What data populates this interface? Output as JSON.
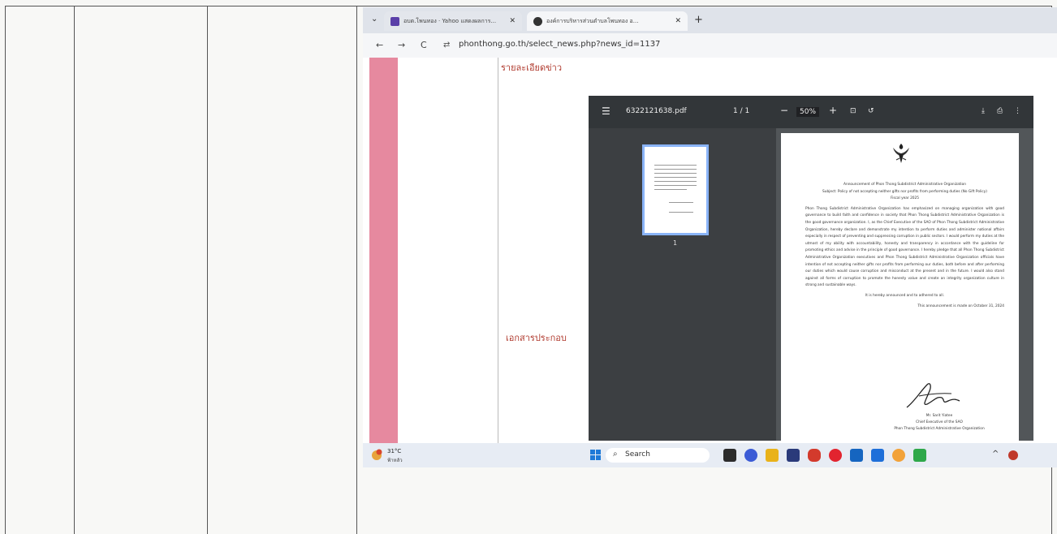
{
  "browser": {
    "tab_arrow": "⌄",
    "tabs": [
      {
        "label": "อบต.โพนทอง · Yahoo แสดงผลการ..."
      },
      {
        "label": "องค์การบริหารส่วนตำบลโพนทอง อ..."
      }
    ],
    "close": "✕",
    "new_tab": "+",
    "back": "←",
    "forward": "→",
    "reload": "C",
    "site_icon": "⇄",
    "url": "phonthong.go.th/select_news.php?news_id=1137"
  },
  "page": {
    "details_title": "รายละเอียดข่าว",
    "attachments_label": "เอกสารประกอบ"
  },
  "pdf_viewer": {
    "menu": "☰",
    "filename": "6322121638.pdf",
    "page_indicator": "1 / 1",
    "zoom_out": "−",
    "zoom": "50%",
    "zoom_in": "+",
    "fit": "⊡",
    "rotate": "↺",
    "download": "⤓",
    "print": "⎙",
    "more": "⋮",
    "thumbnail_page": "1",
    "document": {
      "heading1": "Announcement of Phon Thong Subdistrict Administrative Organization",
      "heading2": "Subject: Policy of not accepting neither gifts nor profits from performing duties (No Gift Policy)",
      "heading3": "Fiscal year 2025",
      "body": "Phon Thong Subdistrict Administrative Organization has emphasized on managing organization with good governance to build faith and confidence in society that Phon Thong Subdistrict Administrative Organization is the good governance organization. I, as the Chief Executive of the SAO of Phon Thong Subdistrict Administrative Organization, hereby declare and demonstrate my intention to perform duties and administer national affairs especially in respect of preventing and suppressing corruption in public sectors. I would perform my duties at the utmost of my ability with accountability, honesty and transparency in accordance with the guideline for promoting ethics and advise in the principle of good governance. I hereby pledge that all Phon Thong Subdistrict Administrative Organization executives and Phon Thong Subdistrict Administrative Organization officials have intention of not accepting neither gifts nor profits from performing our duties, both before and after performing our duties which would cause corruption and misconduct at the present and in the future. I would also stand against all forms of corruption to promote the honesty value and create an integrity organization culture in strong and sustainable ways.",
      "closing": "It is hereby announced and to adhered to all.",
      "date_line": "This announcement is made on October 31, 2024",
      "signer_name": "Mr. Sarit  Yiatee",
      "signer_title": "Chief Executive of the SAO",
      "signer_org": "Phon Thong Subdistrict Administrative Organization"
    }
  },
  "taskbar": {
    "temperature": "31°C",
    "condition": "ฟ้าหลัว",
    "search_icon": "⌕",
    "search_placeholder": "Search",
    "tray_chevron": "^"
  },
  "colors": {
    "pink_bar": "#e6899f",
    "heading_text": "#b03a2e",
    "viewer_toolbar": "#323639",
    "thumb_border": "#8ab4f8"
  }
}
